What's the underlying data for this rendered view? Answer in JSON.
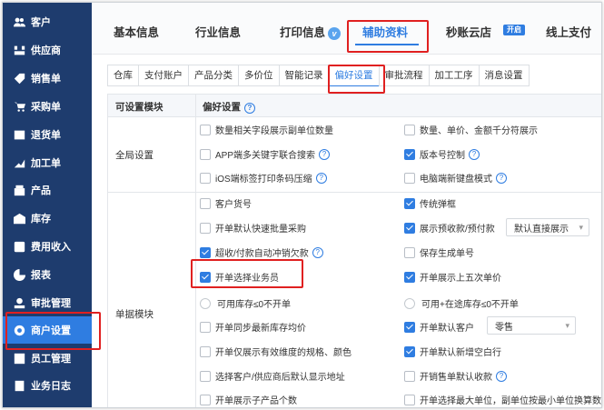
{
  "sidebar": {
    "items": [
      {
        "label": "客户",
        "icon": "users-icon"
      },
      {
        "label": "供应商",
        "icon": "supplier-icon"
      },
      {
        "label": "销售单",
        "icon": "tag-icon"
      },
      {
        "label": "采购单",
        "icon": "cart-icon"
      },
      {
        "label": "退货单",
        "icon": "return-icon"
      },
      {
        "label": "加工单",
        "icon": "process-icon"
      },
      {
        "label": "产品",
        "icon": "box-icon"
      },
      {
        "label": "库存",
        "icon": "warehouse-icon"
      },
      {
        "label": "费用收入",
        "icon": "expense-icon"
      },
      {
        "label": "报表",
        "icon": "chart-icon"
      },
      {
        "label": "审批管理",
        "icon": "approve-icon"
      },
      {
        "label": "商户设置",
        "icon": "gear-icon"
      },
      {
        "label": "员工管理",
        "icon": "staff-icon"
      },
      {
        "label": "业务日志",
        "icon": "log-icon"
      }
    ],
    "active_index": 11
  },
  "top_tabs": {
    "basic": "基本信息",
    "industry": "行业信息",
    "print": "打印信息",
    "print_badge": "v",
    "aux": "辅助资料",
    "yunstore": "秒账云店",
    "open_badge": "开启",
    "online_pay": "线上支付"
  },
  "sub_tabs": [
    "仓库",
    "支付账户",
    "产品分类",
    "多价位",
    "智能记录",
    "偏好设置",
    "审批流程",
    "加工工序",
    "消息设置"
  ],
  "table": {
    "col_module": "可设置模块",
    "col_pref": "偏好设置",
    "global_label": "全局设置",
    "doc_label": "单据模块",
    "global_options": [
      {
        "label": "数量相关字段展示副单位数量",
        "checked": false,
        "help": false
      },
      {
        "label": "数量、单价、金额千分符展示",
        "checked": false,
        "help": false
      },
      {
        "label": "APP端多关键字联合搜索",
        "checked": false,
        "help": true
      },
      {
        "label": "版本号控制",
        "checked": true,
        "help": true
      },
      {
        "label": "iOS端标签打印条码压缩",
        "checked": false,
        "help": true
      },
      {
        "label": "电脑端新键盘模式",
        "checked": false,
        "help": true
      }
    ],
    "doc_options": [
      {
        "label": "客户货号",
        "checked": false,
        "type": "checkbox"
      },
      {
        "label": "传统弹框",
        "checked": true,
        "type": "checkbox"
      },
      {
        "label": "开单默认快速批量采购",
        "checked": false,
        "type": "checkbox"
      },
      {
        "label": "展示预收款/预付款",
        "checked": true,
        "type": "checkbox"
      },
      {
        "label": "超收/付款自动冲销欠款",
        "checked": true,
        "type": "checkbox",
        "help": true
      },
      {
        "label": "保存生成单号",
        "checked": false,
        "type": "checkbox"
      },
      {
        "label": "开单选择业务员",
        "checked": true,
        "type": "checkbox"
      },
      {
        "label": "开单展示上五次单价",
        "checked": true,
        "type": "checkbox"
      },
      {
        "label": "可用库存≤0不开单",
        "checked": false,
        "type": "radio"
      },
      {
        "label": "可用+在途库存≤0不开单",
        "checked": false,
        "type": "radio"
      },
      {
        "label": "开单同步最新库存均价",
        "checked": false,
        "type": "checkbox"
      },
      {
        "label": "开单默认客户",
        "checked": true,
        "type": "checkbox"
      },
      {
        "label": "开单仅展示有效维度的规格、颜色",
        "checked": false,
        "type": "checkbox"
      },
      {
        "label": "开单默认新增空白行",
        "checked": true,
        "type": "checkbox"
      },
      {
        "label": "选择客户/供应商后默认显示地址",
        "checked": false,
        "type": "checkbox"
      },
      {
        "label": "开销售单默认收款",
        "checked": false,
        "type": "checkbox",
        "help": true
      },
      {
        "label": "开单展示子产品个数",
        "checked": false,
        "type": "checkbox"
      },
      {
        "label": "开单选择最大单位，副单位按最小单位换算数量",
        "checked": false,
        "type": "checkbox"
      }
    ],
    "prepay_select": "默认直接展示",
    "default_customer_select": "零售"
  },
  "accent_color": "#2f7de1",
  "sidebar_color": "#1e3c6e",
  "highlight_color": "#e02020"
}
